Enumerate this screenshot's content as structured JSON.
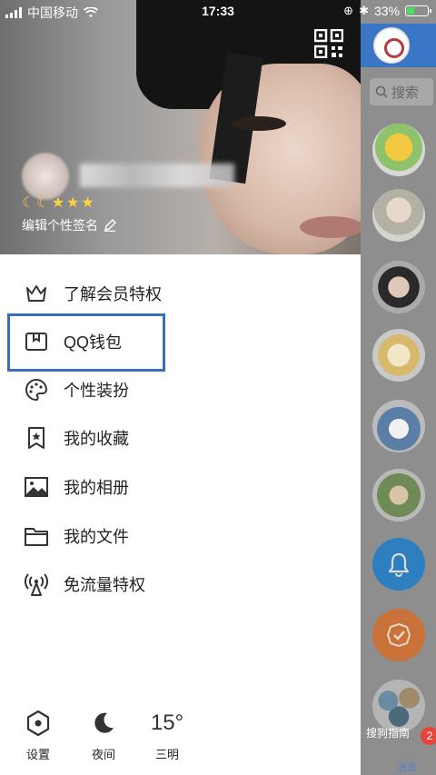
{
  "status": {
    "carrier": "中国移动",
    "time": "17:33",
    "battery_pct": "33%"
  },
  "header": {
    "signature_label": "编辑个性签名"
  },
  "menu": {
    "items": [
      {
        "label": "了解会员特权",
        "icon": "crown-icon"
      },
      {
        "label": "QQ钱包",
        "icon": "wallet-icon"
      },
      {
        "label": "个性装扮",
        "icon": "palette-icon"
      },
      {
        "label": "我的收藏",
        "icon": "bookmark-star-icon"
      },
      {
        "label": "我的相册",
        "icon": "photo-icon"
      },
      {
        "label": "我的文件",
        "icon": "folder-icon"
      },
      {
        "label": "免流量特权",
        "icon": "antenna-icon"
      }
    ]
  },
  "bottom": {
    "settings_label": "设置",
    "night_label": "夜间",
    "temperature": "15°",
    "city": "三明"
  },
  "right_panel": {
    "search_placeholder": "搜索",
    "watermark": "搜狗指南",
    "badge_count": "2",
    "messages_label": "消息"
  },
  "colors": {
    "accent_blue": "#3b75c6",
    "highlight_border": "#3a6fbe",
    "battery_green": "#4cd964"
  }
}
